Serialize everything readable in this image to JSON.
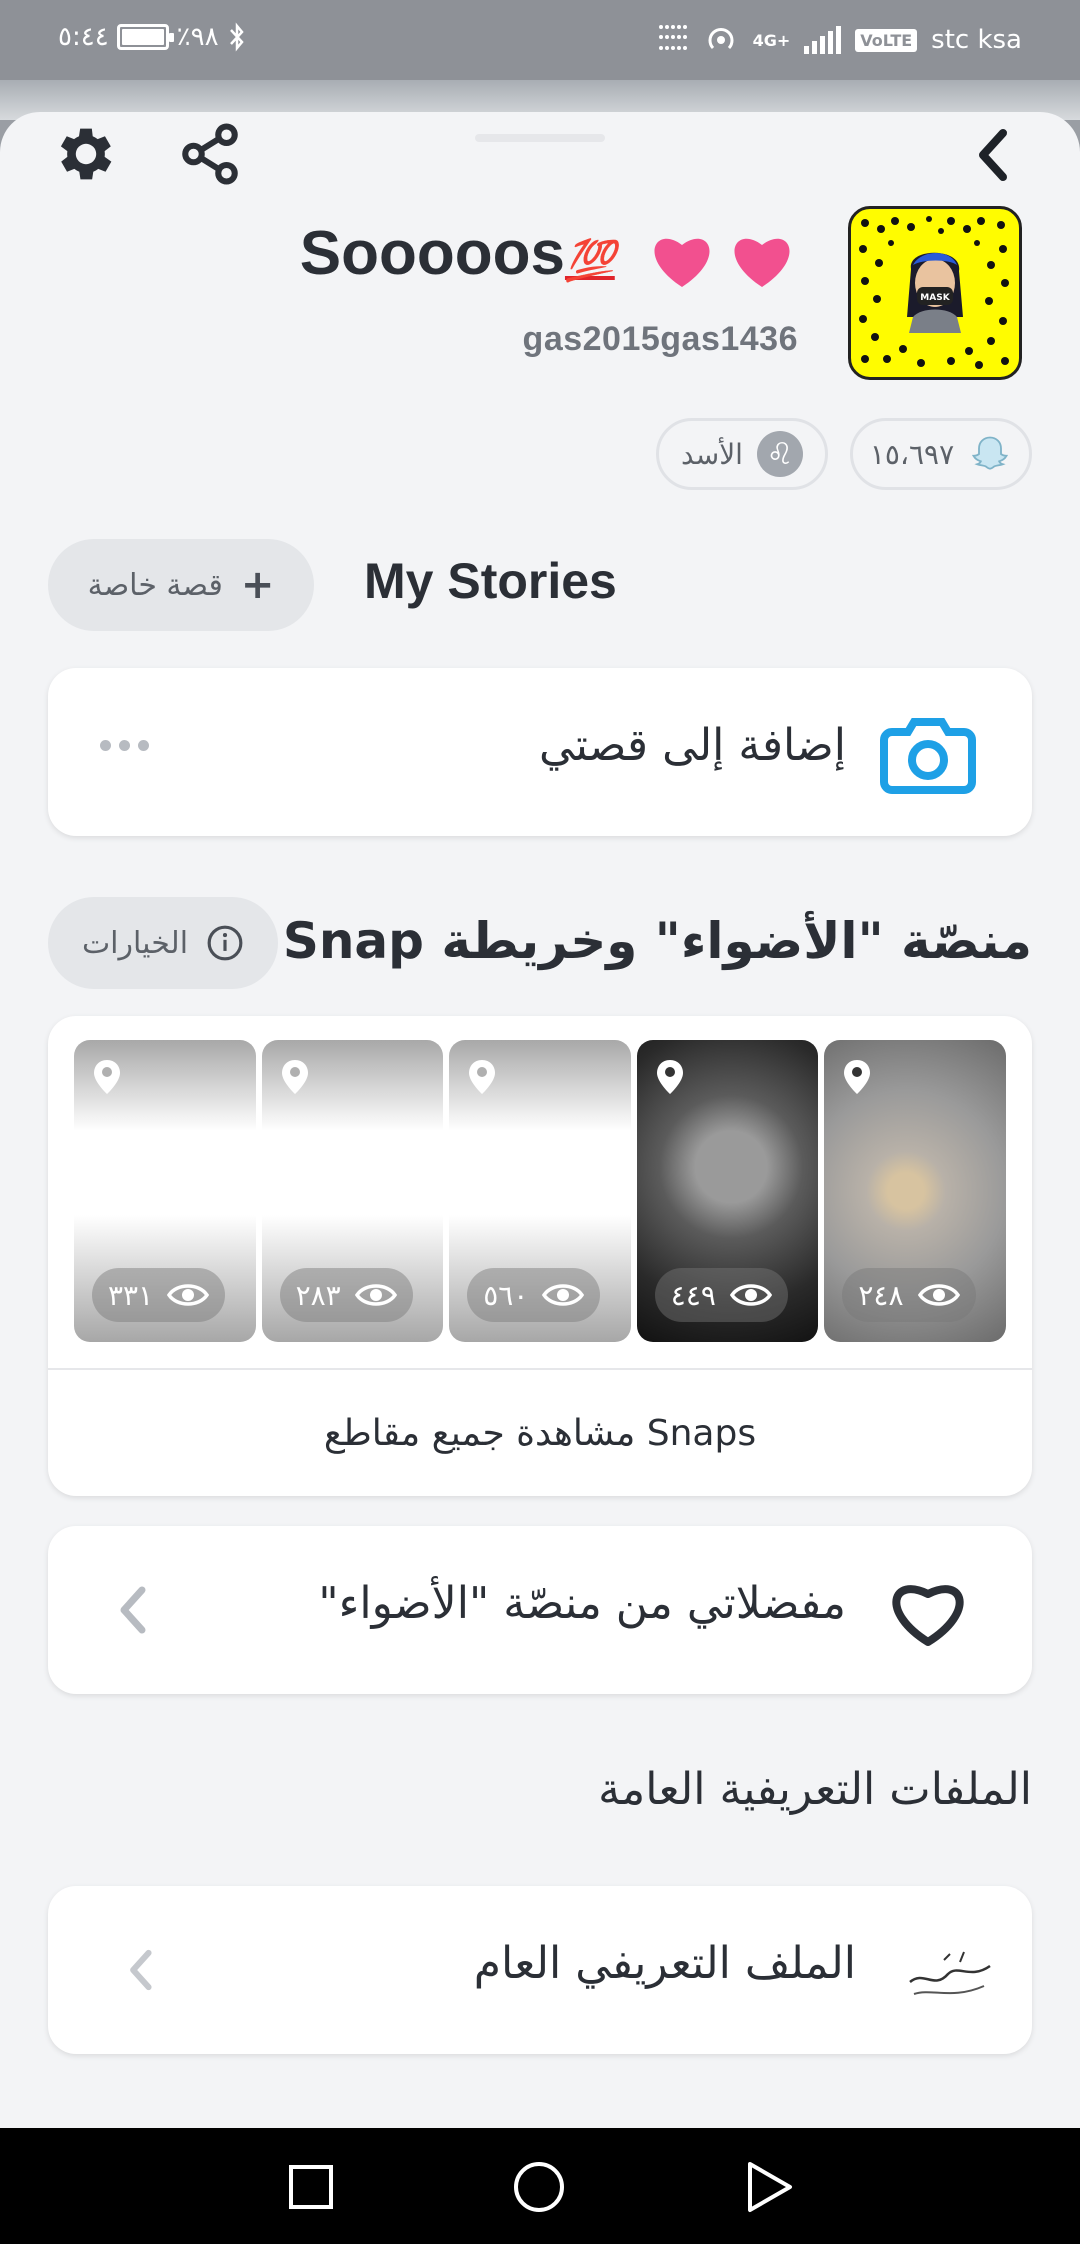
{
  "status_bar": {
    "time": "٥:٤٤",
    "battery": "٪٩٨",
    "network": "4G+",
    "volte": "VoLTE",
    "carrier": "stc ksa"
  },
  "profile": {
    "display_name": "Sooooos",
    "emoji_badge": "💯",
    "username": "gas2015gas1436",
    "snap_score": "١٥،٦٩٧",
    "zodiac": "الأسد"
  },
  "my_stories": {
    "title": "My Stories",
    "private_story_button": "قصة خاصة",
    "add_to_story": "إضافة إلى قصتي"
  },
  "spotlight": {
    "title": "منصّة \"الأضواء\" وخريطة Snap",
    "options_button": "الخيارات",
    "tiles": [
      {
        "kind": "blank",
        "views": "٣٣١"
      },
      {
        "kind": "blank",
        "views": "٢٨٣"
      },
      {
        "kind": "blank",
        "views": "٥٦٠"
      },
      {
        "kind": "photo",
        "views": "٤٤٩"
      },
      {
        "kind": "cartoon",
        "views": "٢٤٨"
      }
    ],
    "see_all": "مشاهدة جميع مقاطع Snaps"
  },
  "favorites": {
    "label": "مفضلاتي من منصّة \"الأضواء\""
  },
  "public_profiles": {
    "title": "الملفات التعريفية العامة",
    "item_label": "الملف التعريفي العام"
  },
  "colors": {
    "snapcode_yellow": "#fffc00",
    "camera_blue": "#1ea0e6",
    "heart_pink": "#f2508f"
  },
  "icons": [
    "back-icon",
    "share-icon",
    "settings-icon",
    "camera-icon",
    "heart-icon",
    "location-pin-icon",
    "eye-icon",
    "info-icon",
    "plus-icon",
    "ghost-icon",
    "leo-icon",
    "chevron-left-icon"
  ]
}
